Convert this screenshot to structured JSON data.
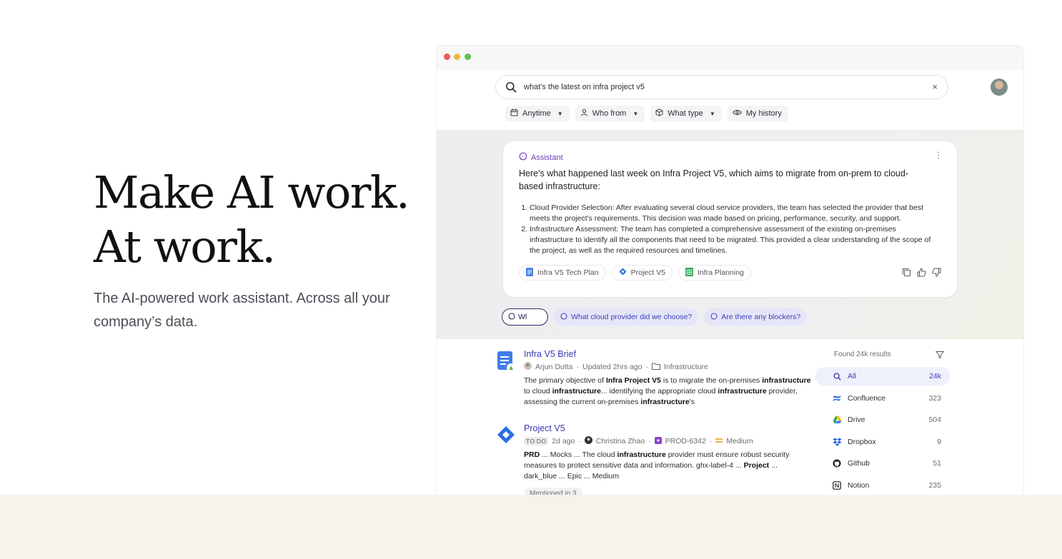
{
  "hero": {
    "headline_line1": "Make AI work.",
    "headline_line2": "At work.",
    "subheadline": "The AI-powered work assistant. Across all your company’s data."
  },
  "search": {
    "query": "what's the latest on infra project v5",
    "clear_glyph": "×"
  },
  "filters": [
    {
      "label": "Anytime",
      "icon": "calendar-icon"
    },
    {
      "label": "Who from",
      "icon": "person-icon"
    },
    {
      "label": "What type",
      "icon": "cube-icon"
    },
    {
      "label": "My history",
      "icon": "eye-icon"
    }
  ],
  "assistant": {
    "label": "Assistant",
    "lead": "Here's what happened last week on Infra Project V5, which aims to migrate from on-prem to cloud-based infrastructure:",
    "points": [
      "Cloud Provider Selection: After evaluating several cloud service providers, the team has selected the provider that best meets the project's requirements. This decision was made based on pricing, performance, security, and support.",
      "Infrastructure Assessment: The team has completed a comprehensive assessment of the existing on-premises infrastructure to identify all the components that need to be migrated. This provided a clear understanding of the scope of the project, as well as the required resources and timelines."
    ],
    "sources": [
      {
        "label": "Infra V5 Tech Plan",
        "icon": "doc-icon"
      },
      {
        "label": "Project V5",
        "icon": "jira-icon"
      },
      {
        "label": "Infra Planning",
        "icon": "sheet-icon"
      }
    ]
  },
  "followups": {
    "input_value": "Wl",
    "suggestions": [
      "What cloud provider did we choose?",
      "Are there any blockers?"
    ]
  },
  "results": [
    {
      "title": "Infra V5 Brief",
      "author": "Arjun Dutta",
      "updated": "Updated 2hrs ago",
      "folder": "Infrastructure"
    },
    {
      "title": "Project V5",
      "status": "TO DO",
      "age": "2d ago",
      "author": "Christina Zhao",
      "ticket": "PROD-6342",
      "priority": "Medium",
      "mentioned": "Mentioned in 3"
    }
  ],
  "facets": {
    "found": "Found 24k results",
    "items": [
      {
        "label": "All",
        "count": "24k",
        "icon": "search-icon"
      },
      {
        "label": "Confluence",
        "count": "323",
        "icon": "confluence-icon"
      },
      {
        "label": "Drive",
        "count": "504",
        "icon": "drive-icon"
      },
      {
        "label": "Dropbox",
        "count": "9",
        "icon": "dropbox-icon"
      },
      {
        "label": "Github",
        "count": "51",
        "icon": "github-icon"
      },
      {
        "label": "Notion",
        "count": "235",
        "icon": "notion-icon"
      }
    ]
  }
}
